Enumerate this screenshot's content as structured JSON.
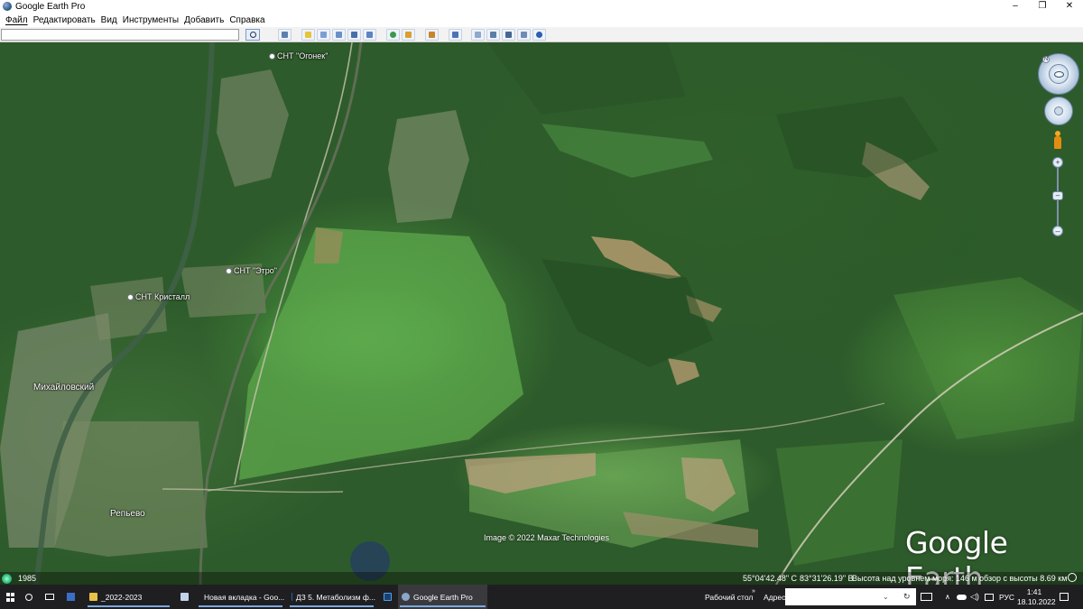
{
  "window": {
    "title": "Google Earth Pro",
    "controls": [
      "–",
      "❐",
      "✕"
    ]
  },
  "menu": [
    "Файл",
    "Редактировать",
    "Вид",
    "Инструменты",
    "Добавить",
    "Справка"
  ],
  "search": {
    "value": "",
    "placeholder": ""
  },
  "map": {
    "placemarks": {
      "ogonek": "СНТ \"Огонек\"",
      "etro": "СНТ \"Этро\"",
      "kristall": "СНТ Кристалл"
    },
    "towns": {
      "mikhailovsky": "Михайловский",
      "repyevo": "Репьево"
    },
    "copyright": "Image © 2022 Maxar Technologies",
    "logo": "Google Earth",
    "history_year": "1985",
    "status": {
      "lat": "55°04'42.48\" С",
      "lon": "83°31'26.19\" В",
      "elevation": "Высота над уровнем моря:   146 м",
      "eye_alt": "обзор с высоты   8.69 км"
    }
  },
  "taskbar": {
    "items": {
      "folder": "_2022-2023",
      "chrome": "Новая вкладка - Goo...",
      "word": "ДЗ 5. Метаболизм ф...",
      "ge": "Google Earth Pro"
    },
    "desktop_label": "Рабочий стол",
    "address_label": "Адрес",
    "lang": "РУС",
    "time": "1:41",
    "date": "18.10.2022"
  }
}
